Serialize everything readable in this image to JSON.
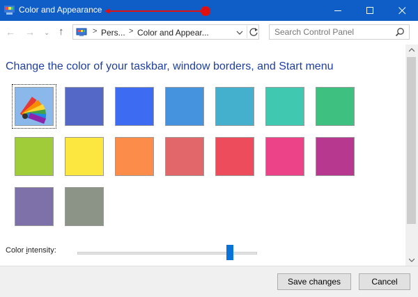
{
  "window": {
    "title": "Color and Appearance",
    "minimize_glyph": "—",
    "maximize_glyph": "☐",
    "close_glyph": "✕",
    "titlebar_color": "#0f5ec8"
  },
  "navigation": {
    "back_glyph": "←",
    "forward_glyph": "→",
    "recent_glyph": "⌄",
    "up_glyph": "↑",
    "breadcrumb": [
      "Pers...",
      "Color and Appear..."
    ],
    "breadcrumb_separator": ">",
    "search_placeholder": "Search Control Panel"
  },
  "main": {
    "heading": "Change the color of your taskbar, window borders, and Start menu",
    "selected_index": 0,
    "swatches": [
      {
        "name": "automatic",
        "color": "#8ab8ea"
      },
      {
        "name": "slate-blue",
        "color": "#5468c8"
      },
      {
        "name": "blue",
        "color": "#3d6cf2"
      },
      {
        "name": "sky-blue",
        "color": "#4593df"
      },
      {
        "name": "teal",
        "color": "#45b0cd"
      },
      {
        "name": "aqua",
        "color": "#40c8b0"
      },
      {
        "name": "green",
        "color": "#3ec080"
      },
      {
        "name": "lime",
        "color": "#a0cc3a"
      },
      {
        "name": "yellow",
        "color": "#fce640"
      },
      {
        "name": "orange",
        "color": "#fc8c4a"
      },
      {
        "name": "salmon",
        "color": "#e2676a"
      },
      {
        "name": "red",
        "color": "#ec4c5c"
      },
      {
        "name": "pink",
        "color": "#ec4287"
      },
      {
        "name": "magenta",
        "color": "#b6388f"
      },
      {
        "name": "lavender",
        "color": "#7e70a8"
      },
      {
        "name": "gray",
        "color": "#8c9488"
      }
    ],
    "intensity_label": "Color intensity:",
    "intensity_value": 0.85
  },
  "footer": {
    "save_label": "Save changes",
    "cancel_label": "Cancel"
  }
}
